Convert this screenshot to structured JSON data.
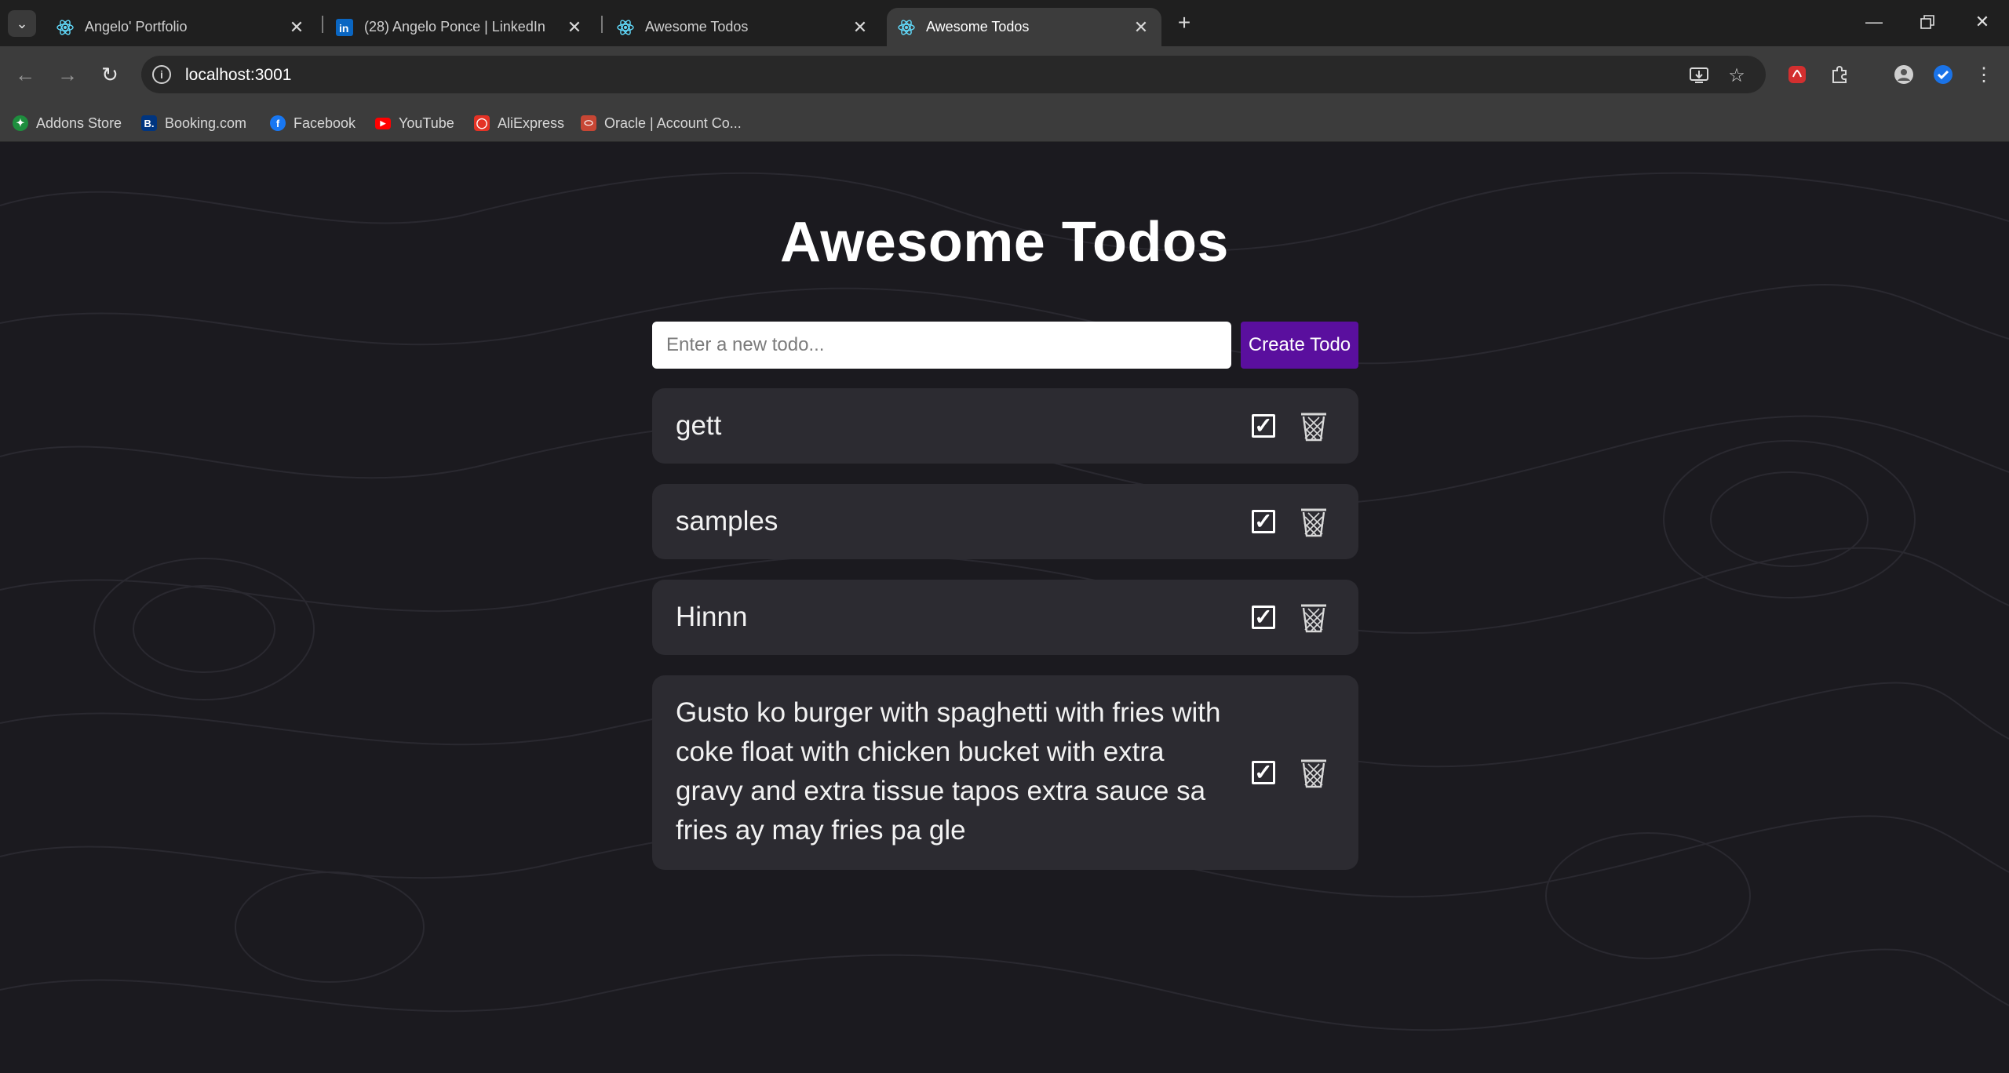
{
  "browser": {
    "tabs": [
      {
        "title": "Angelo' Portfolio",
        "icon": "react-icon",
        "active": false
      },
      {
        "title": "(28) Angelo Ponce | LinkedIn",
        "icon": "linkedin-icon",
        "active": false
      },
      {
        "title": "Awesome Todos",
        "icon": "react-icon",
        "active": false
      },
      {
        "title": "Awesome Todos",
        "icon": "react-icon",
        "active": true
      }
    ],
    "url": "localhost:3001",
    "bookmarks": [
      {
        "label": "Addons Store",
        "icon": "addons-icon",
        "color": "#1e8e3e"
      },
      {
        "label": "Booking.com",
        "icon": "booking-icon",
        "color": "#003580"
      },
      {
        "label": "Facebook",
        "icon": "facebook-icon",
        "color": "#1877f2"
      },
      {
        "label": "YouTube",
        "icon": "youtube-icon",
        "color": "#ff0000"
      },
      {
        "label": "AliExpress",
        "icon": "aliexpress-icon",
        "color": "#e43225"
      },
      {
        "label": "Oracle | Account Co...",
        "icon": "oracle-icon",
        "color": "#c74634"
      }
    ]
  },
  "app": {
    "title": "Awesome Todos",
    "input_placeholder": "Enter a new todo...",
    "input_value": "",
    "create_label": "Create Todo",
    "accent_color": "#5a0f9e",
    "todos": [
      {
        "text": "gett",
        "completed": false
      },
      {
        "text": "samples",
        "completed": false
      },
      {
        "text": "Hinnn",
        "completed": false
      },
      {
        "text_lines": [
          "Gusto ko burger with spaghetti with fries with",
          "coke float with chicken bucket with extra",
          "gravy and extra tissue tapos extra sauce sa",
          "fries ay may fries pa gle"
        ],
        "completed": false
      }
    ]
  }
}
